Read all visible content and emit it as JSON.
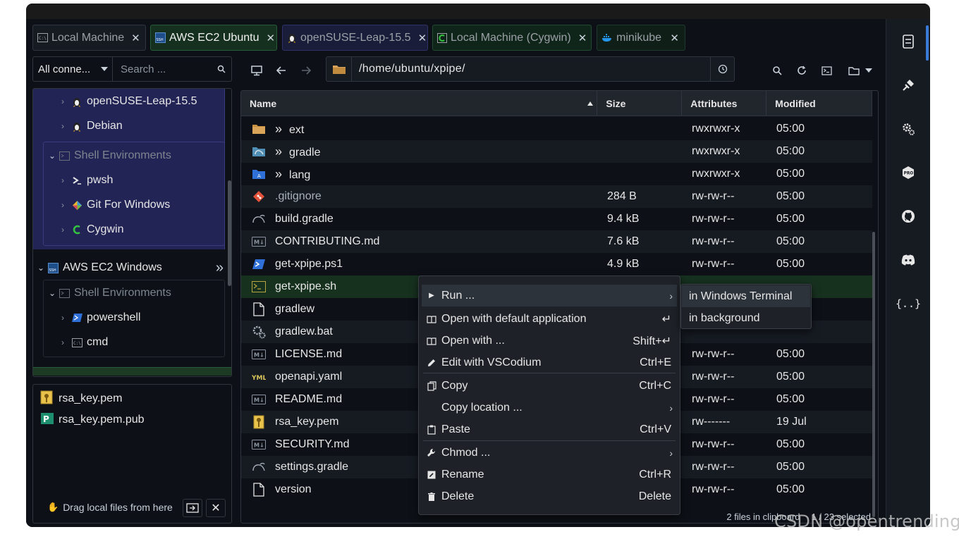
{
  "tabs": [
    {
      "label": "Local Machine",
      "icon": "terminal-icon"
    },
    {
      "label": "AWS EC2 Ubuntu",
      "icon": "ssh-icon"
    },
    {
      "label": "openSUSE-Leap-15.5",
      "icon": "linux-icon"
    },
    {
      "label": "Local Machine (Cygwin)",
      "icon": "cygwin-icon"
    },
    {
      "label": "minikube",
      "icon": "docker-icon"
    }
  ],
  "tab_close_glyph": "✕",
  "filter": {
    "selected": "All conne...",
    "search_placeholder": "Search ..."
  },
  "tree": {
    "items": [
      {
        "label": "openSUSE-Leap-15.5"
      },
      {
        "label": "Debian"
      },
      {
        "label": "Shell Environments"
      },
      {
        "label": "pwsh"
      },
      {
        "label": "Git For Windows"
      },
      {
        "label": "Cygwin"
      },
      {
        "label": "AWS EC2 Windows"
      },
      {
        "label": "Shell Environments"
      },
      {
        "label": "powershell"
      },
      {
        "label": "cmd"
      }
    ]
  },
  "local_files": [
    {
      "name": "rsa_key.pem"
    },
    {
      "name": "rsa_key.pem.pub"
    }
  ],
  "drag_label": "Drag local files from here",
  "path": "/home/ubuntu/xpipe/",
  "columns": {
    "name": "Name",
    "size": "Size",
    "attributes": "Attributes",
    "modified": "Modified"
  },
  "files": [
    {
      "name": "ext",
      "size": "",
      "attr": "rwxrwxr-x",
      "mod": "05:00",
      "icon": "folder-icon",
      "link": true
    },
    {
      "name": "gradle",
      "size": "",
      "attr": "rwxrwxr-x",
      "mod": "05:00",
      "icon": "gradle-folder-icon",
      "link": true
    },
    {
      "name": "lang",
      "size": "",
      "attr": "rwxrwxr-x",
      "mod": "05:00",
      "icon": "lang-folder-icon",
      "link": true
    },
    {
      "name": ".gitignore",
      "size": "284 B",
      "attr": "rw-rw-r--",
      "mod": "05:00",
      "icon": "git-icon"
    },
    {
      "name": "build.gradle",
      "size": "9.4 kB",
      "attr": "rw-rw-r--",
      "mod": "05:00",
      "icon": "gradle-icon"
    },
    {
      "name": "CONTRIBUTING.md",
      "size": "7.6 kB",
      "attr": "rw-rw-r--",
      "mod": "05:00",
      "icon": "markdown-icon"
    },
    {
      "name": "get-xpipe.ps1",
      "size": "4.9 kB",
      "attr": "rw-rw-r--",
      "mod": "05:00",
      "icon": "powershell-icon"
    },
    {
      "name": "get-xpipe.sh",
      "size": "",
      "attr": "",
      "mod": "",
      "icon": "shell-script-icon"
    },
    {
      "name": "gradlew",
      "size": "",
      "attr": "",
      "mod": "",
      "icon": "file-icon"
    },
    {
      "name": "gradlew.bat",
      "size": "",
      "attr": "",
      "mod": "",
      "icon": "batch-icon"
    },
    {
      "name": "LICENSE.md",
      "size": "",
      "attr": "rw-rw-r--",
      "mod": "05:00",
      "icon": "markdown-icon"
    },
    {
      "name": "openapi.yaml",
      "size": "",
      "attr": "rw-rw-r--",
      "mod": "05:00",
      "icon": "yaml-icon"
    },
    {
      "name": "README.md",
      "size": "",
      "attr": "rw-rw-r--",
      "mod": "05:00",
      "icon": "markdown-icon"
    },
    {
      "name": "rsa_key.pem",
      "size": "",
      "attr": "rw-------",
      "mod": "19 Jul",
      "icon": "key-icon"
    },
    {
      "name": "SECURITY.md",
      "size": "",
      "attr": "rw-rw-r--",
      "mod": "05:00",
      "icon": "markdown-icon"
    },
    {
      "name": "settings.gradle",
      "size": "",
      "attr": "rw-rw-r--",
      "mod": "05:00",
      "icon": "gradle-icon"
    },
    {
      "name": "version",
      "size": "",
      "attr": "rw-rw-r--",
      "mod": "05:00",
      "icon": "file-icon"
    }
  ],
  "status": {
    "clipboard": "2 files in clipboard",
    "selection": "1 / 23 selected"
  },
  "context_menu": {
    "items": [
      {
        "label": "Run ...",
        "shortcut": ""
      },
      {
        "label": "Open with default application",
        "shortcut": "↵"
      },
      {
        "label": "Open with ...",
        "shortcut": "Shift+↵"
      },
      {
        "label": "Edit with VSCodium",
        "shortcut": "Ctrl+E"
      },
      {
        "label": "Copy",
        "shortcut": "Ctrl+C"
      },
      {
        "label": "Copy location ...",
        "shortcut": ""
      },
      {
        "label": "Paste",
        "shortcut": "Ctrl+V"
      },
      {
        "label": "Chmod ...",
        "shortcut": ""
      },
      {
        "label": "Rename",
        "shortcut": "Ctrl+R"
      },
      {
        "label": "Delete",
        "shortcut": "Delete"
      }
    ],
    "submenu": [
      {
        "label": "in Windows Terminal"
      },
      {
        "label": "in background"
      }
    ]
  },
  "sidebar": {
    "icons": [
      "connections-icon",
      "plug-icon",
      "settings-icon",
      "pro-icon",
      "github-icon",
      "discord-icon",
      "api-icon"
    ],
    "api_glyph": "{..}",
    "pro_glyph": "PRO"
  },
  "watermark": "CSDN @opentrending",
  "colors": {
    "accent": "#3b7bd8",
    "selected_row": "#17311f",
    "tree_highlight": "#232456"
  }
}
